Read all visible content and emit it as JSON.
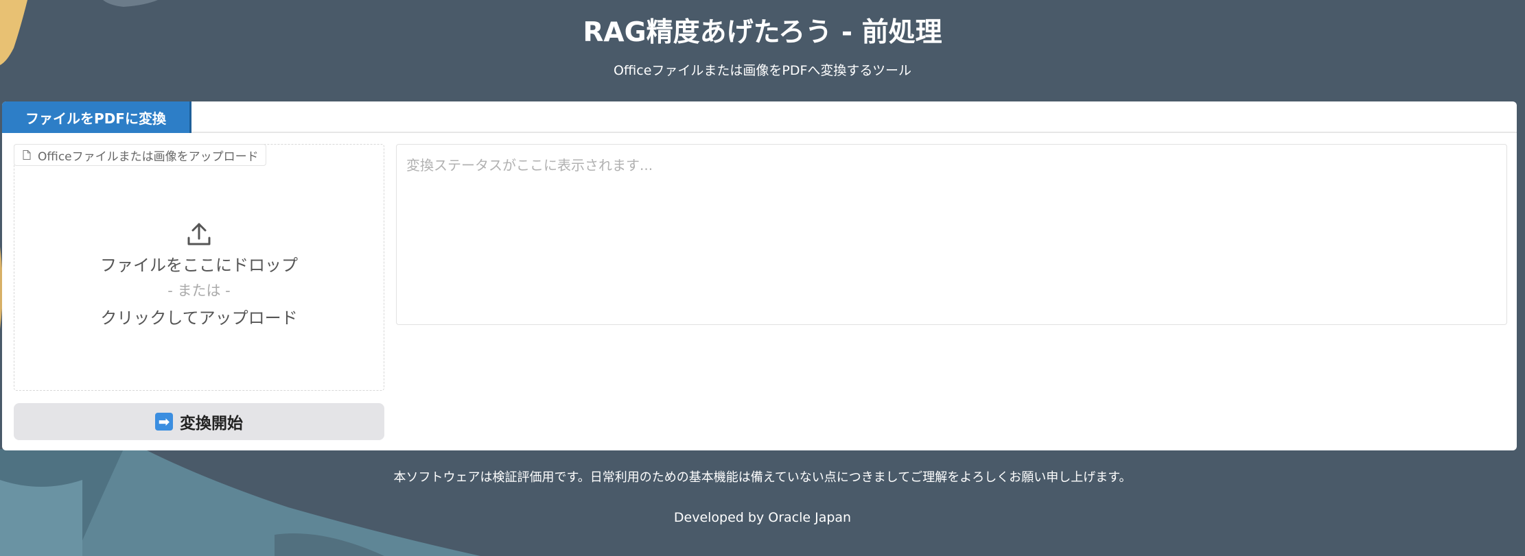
{
  "header": {
    "title": "RAG精度あげたろう - 前処理",
    "subtitle": "Officeファイルまたは画像をPDFへ変換するツール"
  },
  "tabs": [
    {
      "label": "ファイルをPDFに変換",
      "active": true
    }
  ],
  "upload": {
    "label": "Officeファイルまたは画像をアップロード",
    "drop_text": "ファイルをここにドロップ",
    "or_text": "- または -",
    "click_text": "クリックしてアップロード"
  },
  "status": {
    "placeholder": "変換ステータスがここに表示されます..."
  },
  "convert_button": {
    "icon": "➡",
    "label": "変換開始"
  },
  "footer": {
    "disclaimer": "本ソフトウェアは検証評価用です。日常利用のための基本機能は備えていない点につきましてご理解をよろしくお願い申し上げます。",
    "developed_by": "Developed by Oracle Japan"
  },
  "colors": {
    "background": "#4a5a69",
    "tab_active": "#2d7ec7",
    "button_bg": "#e4e4e7"
  }
}
